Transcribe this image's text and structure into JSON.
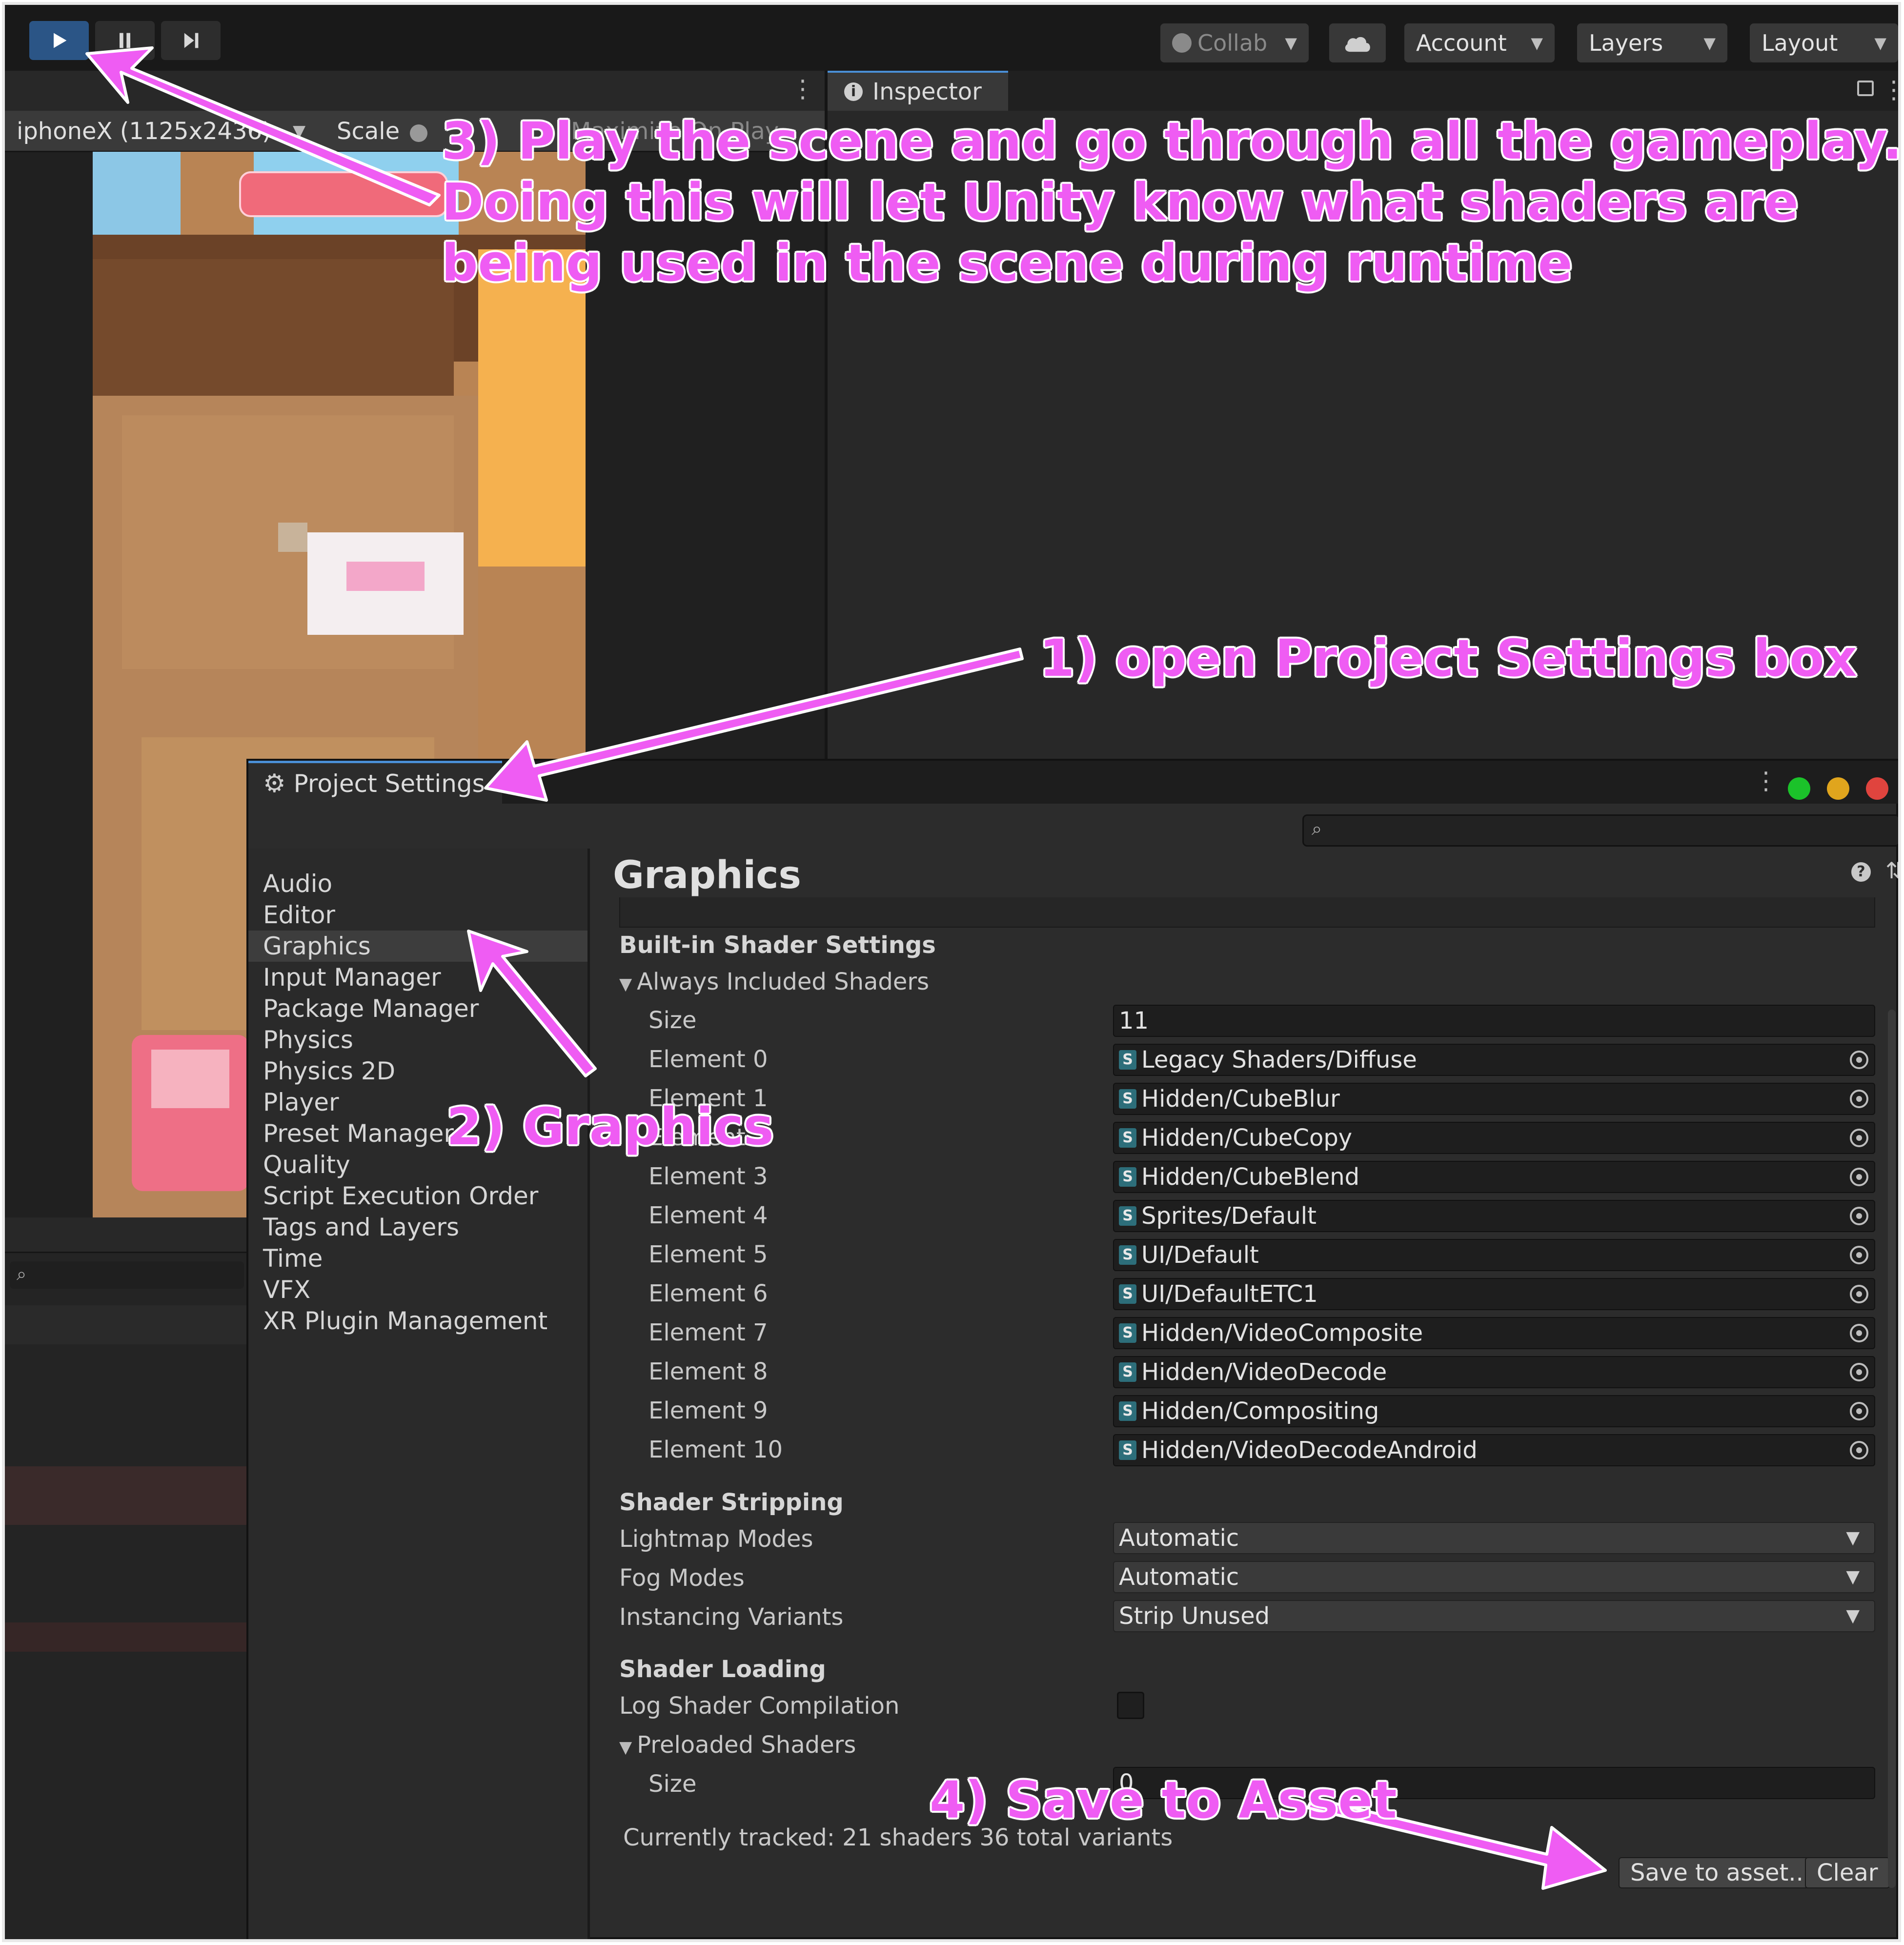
{
  "toolbar": {
    "collab": "Collab",
    "account": "Account",
    "layers": "Layers",
    "layout": "Layout"
  },
  "game_view": {
    "resolution": "iphoneX (1125x2436)",
    "scale_label": "Scale",
    "maximize": "Maximize On Play"
  },
  "inspector": {
    "tab": "Inspector"
  },
  "project_settings": {
    "title": "Project Settings",
    "sidebar": [
      "Audio",
      "Editor",
      "Graphics",
      "Input Manager",
      "Package Manager",
      "Physics",
      "Physics 2D",
      "Player",
      "Preset Manager",
      "Quality",
      "Script Execution Order",
      "Tags and Layers",
      "Time",
      "VFX",
      "XR Plugin Management"
    ],
    "selected": "Graphics",
    "page_title": "Graphics",
    "builtin_header": "Built-in Shader Settings",
    "always_included": "Always Included Shaders",
    "size_label": "Size",
    "size_value": "11",
    "elements": [
      {
        "label": "Element 0",
        "value": "Legacy Shaders/Diffuse"
      },
      {
        "label": "Element 1",
        "value": "Hidden/CubeBlur"
      },
      {
        "label": "Element 2",
        "value": "Hidden/CubeCopy"
      },
      {
        "label": "Element 3",
        "value": "Hidden/CubeBlend"
      },
      {
        "label": "Element 4",
        "value": "Sprites/Default"
      },
      {
        "label": "Element 5",
        "value": "UI/Default"
      },
      {
        "label": "Element 6",
        "value": "UI/DefaultETC1"
      },
      {
        "label": "Element 7",
        "value": "Hidden/VideoComposite"
      },
      {
        "label": "Element 8",
        "value": "Hidden/VideoDecode"
      },
      {
        "label": "Element 9",
        "value": "Hidden/Compositing"
      },
      {
        "label": "Element 10",
        "value": "Hidden/VideoDecodeAndroid"
      }
    ],
    "stripping_header": "Shader Stripping",
    "lightmap_label": "Lightmap Modes",
    "lightmap_value": "Automatic",
    "fog_label": "Fog Modes",
    "fog_value": "Automatic",
    "instancing_label": "Instancing Variants",
    "instancing_value": "Strip Unused",
    "loading_header": "Shader Loading",
    "log_label": "Log Shader Compilation",
    "preloaded_label": "Preloaded Shaders",
    "preload_size_label": "Size",
    "preload_size_value": "0",
    "tracked": "Currently tracked: 21 shaders 36 total variants",
    "save_button": "Save to asset...",
    "clear_button": "Clear"
  },
  "annotations": {
    "step3_line1": "3) Play the scene and go through all the gameplay.",
    "step3_line2": "Doing this will let Unity know what shaders are",
    "step3_line3": "being used in the scene during runtime",
    "step1": "1) open Project Settings box",
    "step2": "2) Graphics",
    "step4": "4) Save to Asset"
  },
  "colors": {
    "accent": "#ef5cf3",
    "play_active": "#2b5586"
  }
}
